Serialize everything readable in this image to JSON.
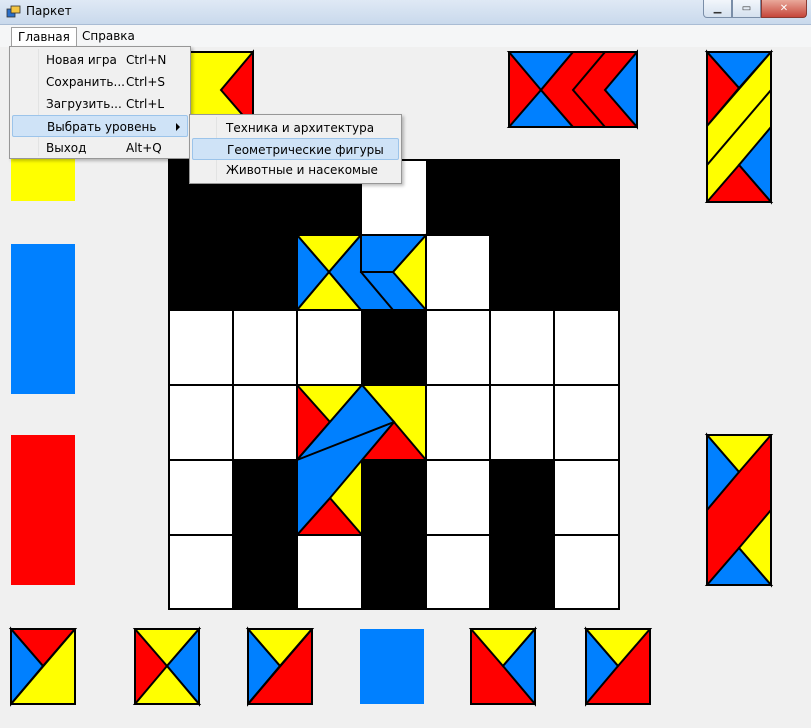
{
  "window": {
    "title": "Паркет"
  },
  "menubar": {
    "items": [
      {
        "label": "Главная"
      },
      {
        "label": "Справка"
      }
    ]
  },
  "main_menu": {
    "items": [
      {
        "label": "Новая игра",
        "shortcut": "Ctrl+N"
      },
      {
        "label": "Сохранить...",
        "shortcut": "Ctrl+S"
      },
      {
        "label": "Загрузить...",
        "shortcut": "Ctrl+L"
      },
      {
        "label": "Выбрать уровень",
        "shortcut": ""
      },
      {
        "label": "Выход",
        "shortcut": "Alt+Q"
      }
    ]
  },
  "level_submenu": {
    "items": [
      {
        "label": "Техника и архитектура"
      },
      {
        "label": "Геометрические фигуры"
      },
      {
        "label": "Животные и насекомые"
      }
    ]
  },
  "colors": {
    "red": "#ff0000",
    "yellow": "#ffff00",
    "blue": "#0080ff",
    "black": "#000000",
    "white": "#ffffff"
  }
}
